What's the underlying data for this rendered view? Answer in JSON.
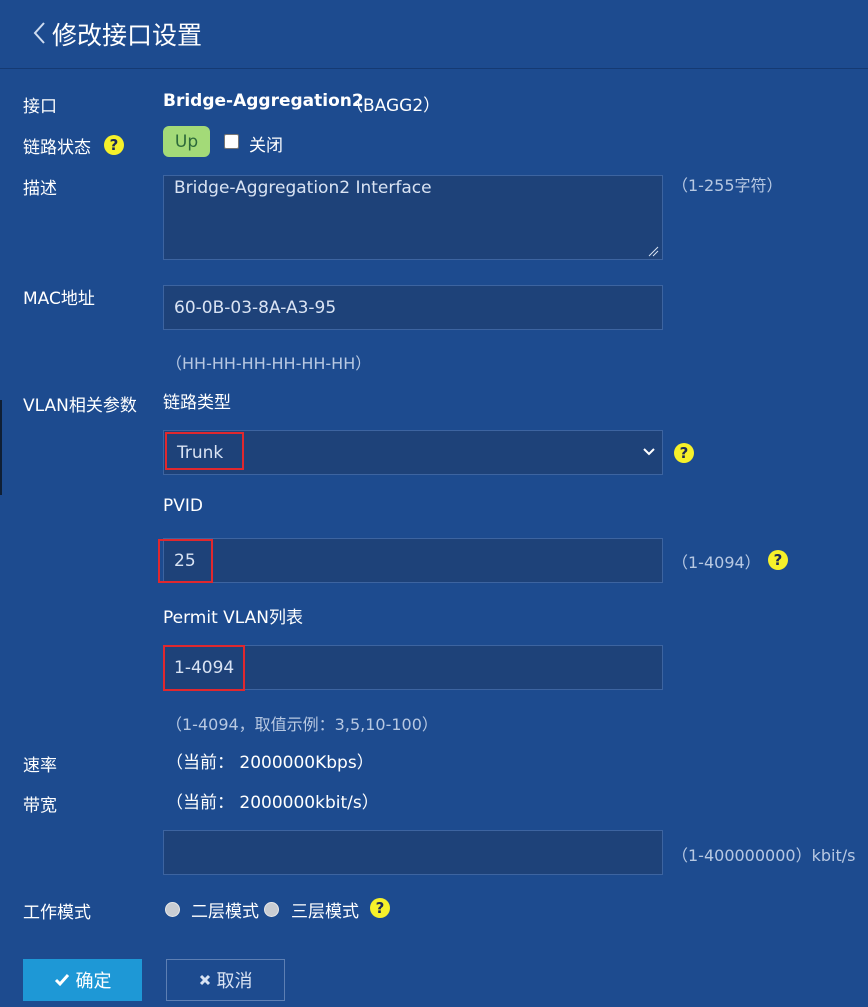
{
  "header": {
    "title": "修改接口设置"
  },
  "interface": {
    "label": "接口",
    "name": "Bridge-Aggregation2",
    "short": "（BAGG2）"
  },
  "link_state": {
    "label": "链路状态",
    "status": "Up",
    "shutdown_label": "关闭",
    "shutdown_checked": false
  },
  "description": {
    "label": "描述",
    "value": "Bridge-Aggregation2 Interface",
    "hint": "（1-255字符）"
  },
  "mac": {
    "label": "MAC地址",
    "value": "60-0B-03-8A-A3-95",
    "hint": "（HH-HH-HH-HH-HH-HH）"
  },
  "vlan": {
    "label": "VLAN相关参数",
    "link_type_label": "链路类型",
    "link_type_value": "Trunk",
    "pvid_label": "PVID",
    "pvid_value": "25",
    "pvid_hint": "（1-4094）",
    "permit_label": "Permit VLAN列表",
    "permit_value": "1-4094",
    "permit_hint": "（1-4094，取值示例：3,5,10-100）"
  },
  "speed": {
    "label": "速率",
    "current": "（当前： 2000000Kbps）"
  },
  "bandwidth": {
    "label": "带宽",
    "current": "（当前： 2000000kbit/s）",
    "value": "",
    "hint": "（1-400000000）kbit/s"
  },
  "work_mode": {
    "label": "工作模式",
    "option1": "二层模式",
    "option2": "三层模式"
  },
  "buttons": {
    "ok": "确定",
    "cancel": "取消"
  },
  "help_glyph": "?",
  "colors": {
    "background": "#1d4b8f",
    "up_badge": "#a3da78",
    "ok_button": "#1e98d6",
    "highlight": "#e0282e",
    "help_icon": "#f6f12a"
  }
}
